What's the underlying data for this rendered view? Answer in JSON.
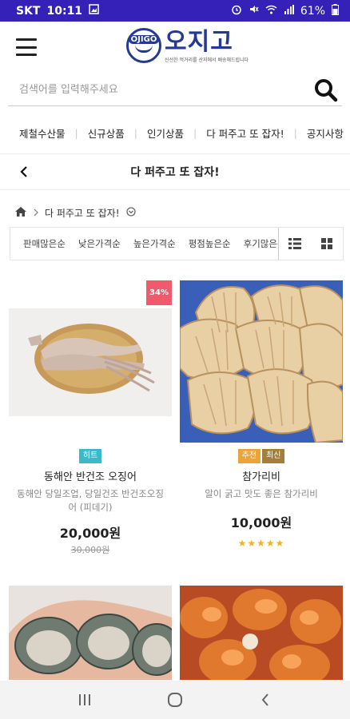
{
  "status_bar": {
    "carrier": "SKT",
    "time": "10:11",
    "battery": "61%"
  },
  "header": {
    "logo_badge": "OJIGO",
    "logo_title": "오지고",
    "logo_tagline": "신선한 먹거리를 산지에서 배송해드립니다",
    "brand_color": "#243a8f"
  },
  "search": {
    "placeholder": "검색어를 입력해주세요"
  },
  "categories": [
    "제철수산물",
    "신규상품",
    "인기상품",
    "다 퍼주고 또 잡자!",
    "공지사항"
  ],
  "page_title": "다 퍼주고 또 잡자!",
  "breadcrumb": {
    "current": "다 퍼주고 또 잡자!"
  },
  "sort_options": [
    "판매많은순",
    "낮은가격순",
    "높은가격순",
    "평점높은순",
    "후기많은순"
  ],
  "products": [
    {
      "discount": "34%",
      "tags": [
        "히트"
      ],
      "name": "동해안 반건조 오징어",
      "desc": "동해안 당일조업, 당일건조 반건조오징어 (피데기)",
      "price": "20,000원",
      "original_price": "30,000원"
    },
    {
      "tags": [
        "추천",
        "최신"
      ],
      "name": "참가리비",
      "desc": "알이 굵고 맛도 좋은 참가리비",
      "price": "10,000원",
      "rating": 5
    },
    {},
    {}
  ],
  "colors": {
    "status_bar": "#3520b8",
    "discount_badge": "#ef5a6d",
    "tag_hit": "#3bb9c9",
    "tag_recommend": "#eaa43b",
    "tag_new": "#a57d3c",
    "star": "#f3b41b"
  }
}
